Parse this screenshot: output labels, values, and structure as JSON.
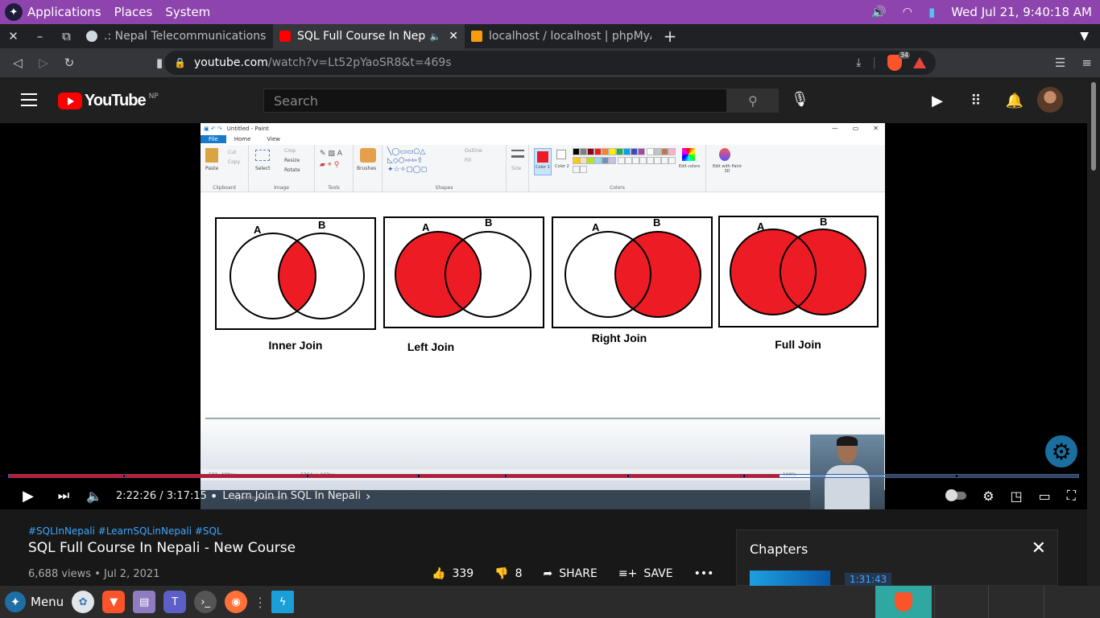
{
  "system_panel": {
    "menu": [
      "Applications",
      "Places",
      "System"
    ],
    "clock": "Wed Jul 21,  9:40:18 AM"
  },
  "tabs": [
    {
      "title": ".: Nepal Telecommunications Au",
      "active": false
    },
    {
      "title": "SQL Full Course In Nepali",
      "active": true
    },
    {
      "title": "localhost / localhost | phpMyAdmin",
      "active": false
    }
  ],
  "address_bar": {
    "host": "youtube.com",
    "path": "/watch?v=Lt52pYaoSR8&t=469s",
    "shield_count": "34"
  },
  "youtube": {
    "logo_text": "YouTube",
    "country": "NP",
    "search_placeholder": "Search"
  },
  "paint": {
    "title": "Untitled - Paint",
    "tabs": [
      "File",
      "Home",
      "View"
    ],
    "groups": [
      "Clipboard",
      "Image",
      "Tools",
      "Shapes",
      "Colors"
    ],
    "tools": {
      "paste": "Paste",
      "cut": "Cut",
      "copy": "Copy",
      "select": "Select",
      "crop": "Crop",
      "resize": "Resize",
      "rotate": "Rotate",
      "brushes": "Brushes",
      "outline": "Outline",
      "fill": "Fill",
      "size": "Size",
      "color1": "Color 1",
      "color2": "Color 2",
      "edit_colors": "Edit colors",
      "edit_3d": "Edit with Paint 3D"
    },
    "status": {
      "pos": "582, 429px",
      "size": "1364 × 443px",
      "zoom": "100%"
    },
    "venn": [
      {
        "label": "Inner Join",
        "a": "A",
        "b": "B",
        "fill": "inner"
      },
      {
        "label": "Left Join",
        "a": "A",
        "b": "B",
        "fill": "left"
      },
      {
        "label": "Right Join",
        "a": "A",
        "b": "B",
        "fill": "right"
      },
      {
        "label": "Full Join",
        "a": "A",
        "b": "B",
        "fill": "full"
      }
    ],
    "taskbar_search": "Type here to search"
  },
  "player": {
    "current_time": "2:22:26",
    "duration": "3:17:15",
    "time_display": "2:22:26 / 3:17:15",
    "chapter": "Learn Join In SQL In Nepali",
    "progress": 0.721,
    "buffered": 0.74
  },
  "video": {
    "hashtags": "#SQLInNepali #LearnSQLinNepali #SQL",
    "title": "SQL Full Course In Nepali - New Course",
    "meta": "6,688 views • Jul 2, 2021",
    "likes": "339",
    "dislikes": "8",
    "share": "SHARE",
    "save": "SAVE"
  },
  "chapters": {
    "title": "Chapters",
    "first_time": "1:31:43"
  },
  "os_taskbar": {
    "menu_label": "Menu"
  },
  "colors": {
    "panel": "#8e44ad",
    "youtube_red": "#ff0000",
    "venn_fill": "#ed1c24",
    "link": "#3ea6ff"
  }
}
